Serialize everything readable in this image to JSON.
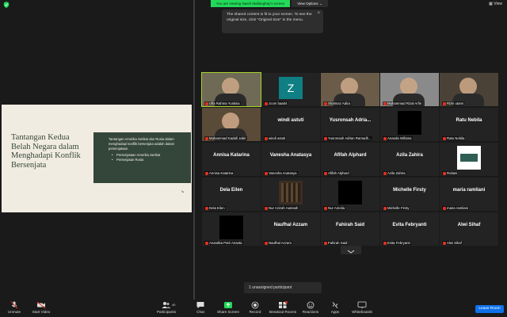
{
  "top": {
    "viewing": "You are viewing Nasril Mallanghay's screen",
    "view_options": "View Options",
    "view": "View"
  },
  "tooltip": {
    "text": "The shared content is fit to your screen. To see the original size, click \"Original Size\" in the menu."
  },
  "slide": {
    "title": "Tantangan Kedua Belah Negara dalam Menghadapi Konflik Bersenjata",
    "panel_text": "Tantangan Amerika Serikat dan Rusia dalam menghadapi konflik bersenjata adalah dalam persenjataan.",
    "bullets": [
      "Persenjataan Amerika Serikat",
      "Persenjatan Rusia"
    ]
  },
  "participants": [
    {
      "label": "Ulfa Rahma Yustisia",
      "big": "",
      "kind": "photo"
    },
    {
      "label": "zcom baa04",
      "big": "Z",
      "kind": "avatar"
    },
    {
      "label": "Shahnaz Adira",
      "big": "",
      "kind": "photo"
    },
    {
      "label": "Muhammad Rizal Arfin",
      "big": "",
      "kind": "photo"
    },
    {
      "label": "Rizki utami",
      "big": "",
      "kind": "photo"
    },
    {
      "label": "Muhammad Kadafi Jabir",
      "big": "",
      "kind": "photo"
    },
    {
      "label": "windi astuti",
      "big": "windi astuti",
      "kind": "name"
    },
    {
      "label": "Yusronsah Adrian Ramadh...",
      "big": "Yusronsah Adria...",
      "kind": "name"
    },
    {
      "label": "Ananda Wifama",
      "big": "",
      "kind": "black"
    },
    {
      "label": "Ratu Nebila",
      "big": "Ratu Nebila",
      "kind": "name"
    },
    {
      "label": "Annisa Katarina",
      "big": "Annisa Katarina",
      "kind": "name"
    },
    {
      "label": "Vanesha Anatasya",
      "big": "Vanesha Anatasya",
      "kind": "name"
    },
    {
      "label": "Afifah Alphard",
      "big": "Afifah Alphard",
      "kind": "name"
    },
    {
      "label": "Azila Zahira",
      "big": "Azila Zahira",
      "kind": "name"
    },
    {
      "label": "Rotiani",
      "big": "",
      "kind": "photo"
    },
    {
      "label": "Dela Eilen",
      "big": "Dela Eilen",
      "kind": "name"
    },
    {
      "label": "Nur Azizah Aanisah",
      "big": "",
      "kind": "photo"
    },
    {
      "label": "Nur Amelia",
      "big": "",
      "kind": "black"
    },
    {
      "label": "Michelle Firsty",
      "big": "Michelle Firsty",
      "kind": "name"
    },
    {
      "label": "maria ramliani",
      "big": "maria ramliani",
      "kind": "name"
    },
    {
      "label": "Anandita Putri Ananta",
      "big": "",
      "kind": "black"
    },
    {
      "label": "Naufhal Azzam",
      "big": "Naufhal Azzam",
      "kind": "name"
    },
    {
      "label": "Fahirah Said",
      "big": "Fahirah Said",
      "kind": "name"
    },
    {
      "label": "Evita Febryanti",
      "big": "Evita Febryanti",
      "kind": "name"
    },
    {
      "label": "Alwi Sihaf",
      "big": "Alwi Sihaf",
      "kind": "name"
    }
  ],
  "unassigned": "1 unassigned participant",
  "toolbar": {
    "unmute": "Unmute",
    "start_video": "Start Video",
    "participants": "Participants",
    "participants_count": "40",
    "chat": "Chat",
    "share_screen": "Share Screen",
    "record": "Record",
    "breakout": "Breakout Rooms",
    "reactions": "Reactions",
    "apps": "Apps",
    "whiteboards": "Whiteboards",
    "leave": "Leave Room"
  },
  "colors": {
    "accent_green": "#23d959",
    "leave_blue": "#0e71eb",
    "slide_bg": "#f1ece1",
    "slide_panel": "#34453a",
    "active_border": "#a6d42b"
  }
}
